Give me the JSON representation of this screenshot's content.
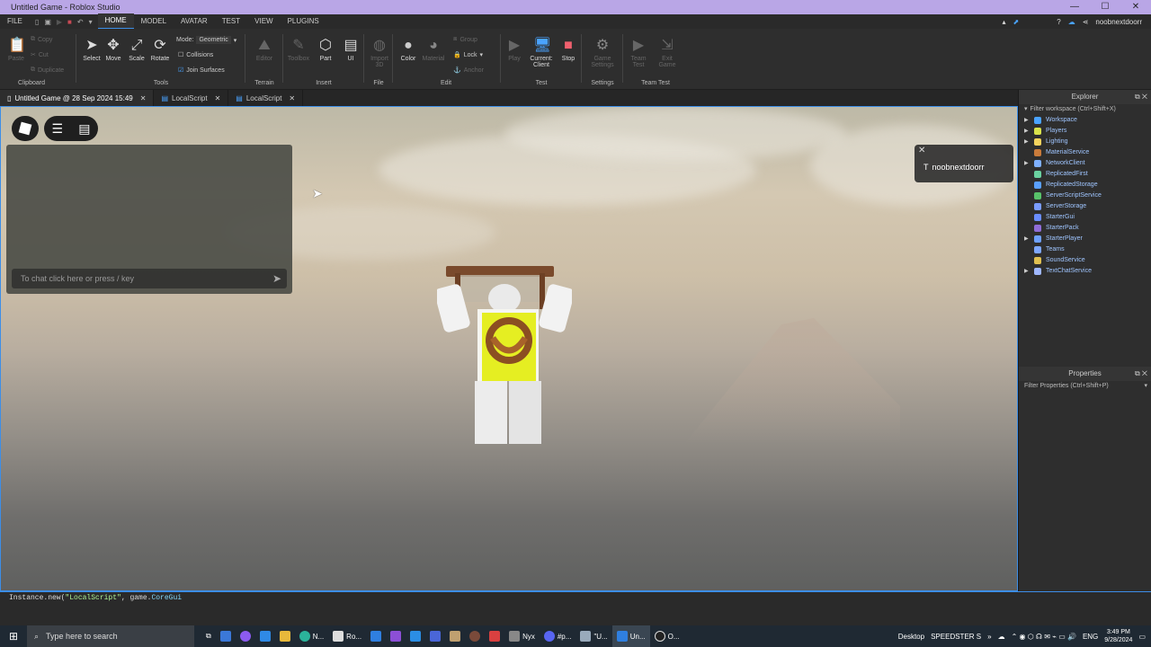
{
  "window": {
    "title": "Untitled Game - Roblox Studio",
    "min": "—",
    "max": "☐",
    "close": "✕"
  },
  "menu": {
    "file": "FILE",
    "tabs": [
      "HOME",
      "MODEL",
      "AVATAR",
      "TEST",
      "VIEW",
      "PLUGINS"
    ],
    "user": "noobnextdoorr"
  },
  "ribbon": {
    "clipboard": {
      "paste": "Paste",
      "copy": "Copy",
      "cut": "Cut",
      "duplicate": "Duplicate",
      "label": "Clipboard"
    },
    "tools": {
      "select": "Select",
      "move": "Move",
      "scale": "Scale",
      "rotate": "Rotate",
      "mode_label": "Mode:",
      "mode_value": "Geometric",
      "collisions": "Collisions",
      "join_surfaces": "Join Surfaces",
      "label": "Tools"
    },
    "terrain": {
      "editor": "Editor",
      "label": "Terrain"
    },
    "insert": {
      "toolbox": "Toolbox",
      "part": "Part",
      "ui": "UI",
      "label": "Insert"
    },
    "file": {
      "import": "Import 3D",
      "label": "File"
    },
    "edit": {
      "color": "Color",
      "material": "Material",
      "group": "Group",
      "lock": "Lock",
      "anchor": "Anchor",
      "label": "Edit"
    },
    "test": {
      "play": "Play",
      "current": "Current: Client",
      "stop": "Stop",
      "label": "Test"
    },
    "settings": {
      "game_settings": "Game Settings",
      "label": "Settings"
    },
    "teamtest": {
      "team_test": "Team Test",
      "exit_game": "Exit Game",
      "label": "Team Test"
    }
  },
  "doc_tabs": [
    {
      "label": "Untitled Game @ 28 Sep 2024 15:49"
    },
    {
      "label": "LocalScript"
    },
    {
      "label": "LocalScript"
    }
  ],
  "game": {
    "chat_placeholder": "To chat click here or press / key",
    "player_name": "noobnextdoorr"
  },
  "explorer": {
    "title": "Explorer",
    "filter": "Filter workspace (Ctrl+Shift+X)",
    "items": [
      "Workspace",
      "Players",
      "Lighting",
      "MaterialService",
      "NetworkClient",
      "ReplicatedFirst",
      "ReplicatedStorage",
      "ServerScriptService",
      "ServerStorage",
      "StarterGui",
      "StarterPack",
      "StarterPlayer",
      "Teams",
      "SoundService",
      "TextChatService"
    ],
    "expandable": [
      true,
      true,
      true,
      false,
      true,
      false,
      false,
      false,
      false,
      false,
      false,
      true,
      false,
      false,
      true
    ],
    "colors": [
      "#4aa3ff",
      "#d9e24b",
      "#f4d35e",
      "#c97b3b",
      "#7fb0ff",
      "#6ad1a0",
      "#5aa0ff",
      "#58c26a",
      "#7a9cff",
      "#6a8dff",
      "#8f6dd8",
      "#6ea0ff",
      "#7ea7ff",
      "#e0c050",
      "#9fb7ff"
    ]
  },
  "properties": {
    "title": "Properties",
    "filter": "Filter Properties (Ctrl+Shift+P)"
  },
  "command": {
    "prefix": "Instance.new(",
    "arg1": "\"LocalScript\"",
    "mid": ", game.",
    "ref": "CoreGui"
  },
  "taskbar": {
    "search": "Type here to search",
    "apps": [
      "N...",
      "Ro...",
      "Nyx",
      "#p...",
      "\"U...",
      "Un...",
      "O..."
    ],
    "desktop": "Desktop",
    "speedster": "SPEEDSTER S",
    "lang": "ENG",
    "time": "3:49 PM",
    "date": "9/28/2024"
  }
}
